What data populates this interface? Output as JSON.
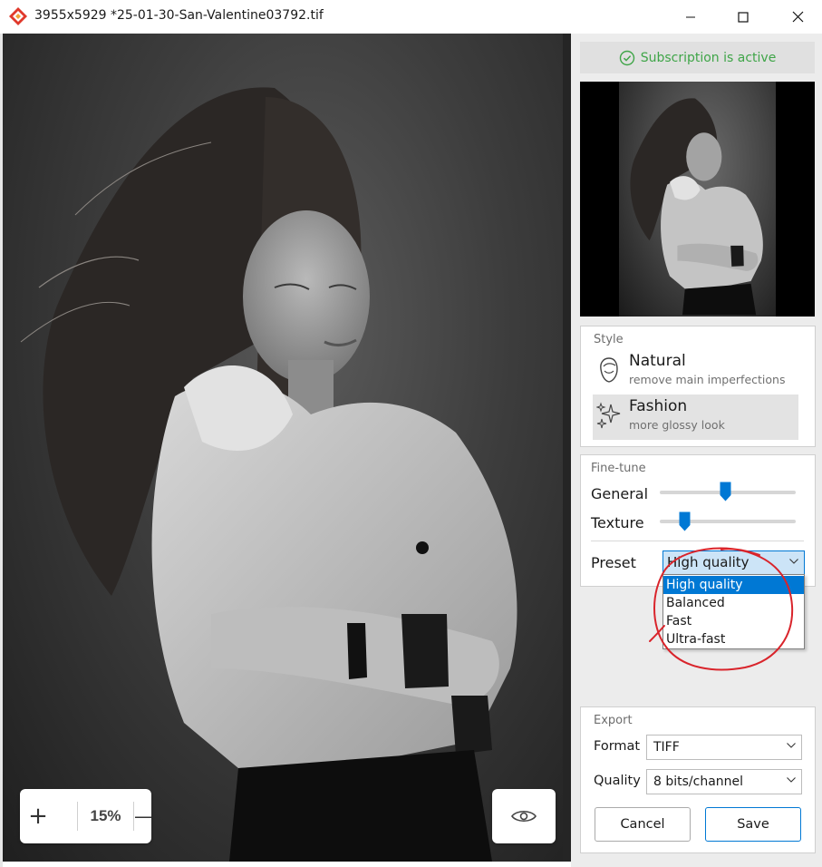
{
  "window": {
    "title": "3955x5929 *25-01-30-San-Valentine03792.tif",
    "controls": {
      "minimize": "minimize",
      "maximize": "maximize",
      "close": "close"
    }
  },
  "viewer": {
    "zoom_in": "+",
    "zoom_value": "15%",
    "zoom_out": "—",
    "preview_icon": "eye-icon"
  },
  "panel": {
    "subscription": {
      "text": "Subscription is active",
      "color": "#3fa548"
    },
    "style": {
      "label": "Style",
      "options": [
        {
          "name": "Natural",
          "desc": "remove main imperfections",
          "icon": "face-icon",
          "selected": false
        },
        {
          "name": "Fashion",
          "desc": "more glossy look",
          "icon": "sparkles-icon",
          "selected": true
        }
      ]
    },
    "finetune": {
      "label": "Fine-tune",
      "general": {
        "label": "General",
        "value": 0.5
      },
      "texture": {
        "label": "Texture",
        "value": 0.18
      },
      "preset": {
        "label": "Preset",
        "value": "High quality",
        "options": [
          "High quality",
          "Balanced",
          "Fast",
          "Ultra-fast"
        ]
      }
    },
    "export": {
      "label": "Export",
      "format": {
        "label": "Format",
        "value": "TIFF"
      },
      "quality": {
        "label": "Quality",
        "value": "8 bits/channel"
      },
      "cancel": "Cancel",
      "save": "Save"
    }
  },
  "accent_color": "#0078d4",
  "annotation_color": "#d9242b"
}
